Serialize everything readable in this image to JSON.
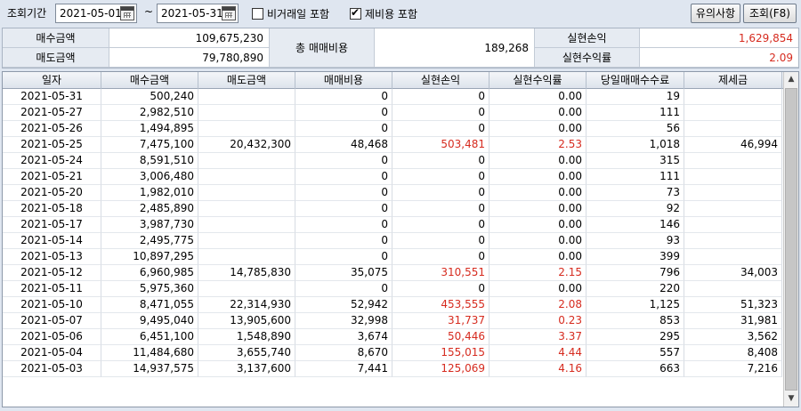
{
  "toolbar": {
    "period_label": "조회기간",
    "date_from": "2021-05-01",
    "tilde": "~",
    "date_to": "2021-05-31",
    "chk_non_trading": "비거래일 포함",
    "chk_fees": "제비용 포함",
    "btn_notice": "유의사항",
    "btn_query": "조회(F8)"
  },
  "summary": {
    "buy_label": "매수금액",
    "buy_value": "109,675,230",
    "sell_label": "매도금액",
    "sell_value": "79,780,890",
    "cost_label": "총 매매비용",
    "cost_value": "189,268",
    "pnl_label": "실현손익",
    "pnl_value": "1,629,854",
    "ret_label": "실현수익률",
    "ret_value": "2.09"
  },
  "table": {
    "headers": [
      "일자",
      "매수금액",
      "매도금액",
      "매매비용",
      "실현손익",
      "실현수익률",
      "당일매매수수료",
      "제세금"
    ],
    "rows": [
      [
        "2021-05-31",
        "500,240",
        "",
        "0",
        "0",
        "0.00",
        "19",
        ""
      ],
      [
        "2021-05-27",
        "2,982,510",
        "",
        "0",
        "0",
        "0.00",
        "111",
        ""
      ],
      [
        "2021-05-26",
        "1,494,895",
        "",
        "0",
        "0",
        "0.00",
        "56",
        ""
      ],
      [
        "2021-05-25",
        "7,475,100",
        "20,432,300",
        "48,468",
        "503,481",
        "2.53",
        "1,018",
        "46,994"
      ],
      [
        "2021-05-24",
        "8,591,510",
        "",
        "0",
        "0",
        "0.00",
        "315",
        ""
      ],
      [
        "2021-05-21",
        "3,006,480",
        "",
        "0",
        "0",
        "0.00",
        "111",
        ""
      ],
      [
        "2021-05-20",
        "1,982,010",
        "",
        "0",
        "0",
        "0.00",
        "73",
        ""
      ],
      [
        "2021-05-18",
        "2,485,890",
        "",
        "0",
        "0",
        "0.00",
        "92",
        ""
      ],
      [
        "2021-05-17",
        "3,987,730",
        "",
        "0",
        "0",
        "0.00",
        "146",
        ""
      ],
      [
        "2021-05-14",
        "2,495,775",
        "",
        "0",
        "0",
        "0.00",
        "93",
        ""
      ],
      [
        "2021-05-13",
        "10,897,295",
        "",
        "0",
        "0",
        "0.00",
        "399",
        ""
      ],
      [
        "2021-05-12",
        "6,960,985",
        "14,785,830",
        "35,075",
        "310,551",
        "2.15",
        "796",
        "34,003"
      ],
      [
        "2021-05-11",
        "5,975,360",
        "",
        "0",
        "0",
        "0.00",
        "220",
        ""
      ],
      [
        "2021-05-10",
        "8,471,055",
        "22,314,930",
        "52,942",
        "453,555",
        "2.08",
        "1,125",
        "51,323"
      ],
      [
        "2021-05-07",
        "9,495,040",
        "13,905,600",
        "32,998",
        "31,737",
        "0.23",
        "853",
        "31,981"
      ],
      [
        "2021-05-06",
        "6,451,100",
        "1,548,890",
        "3,674",
        "50,446",
        "3.37",
        "295",
        "3,562"
      ],
      [
        "2021-05-04",
        "11,484,680",
        "3,655,740",
        "8,670",
        "155,015",
        "4.44",
        "557",
        "8,408"
      ],
      [
        "2021-05-03",
        "14,937,575",
        "3,137,600",
        "7,441",
        "125,069",
        "4.16",
        "663",
        "7,216"
      ]
    ]
  },
  "colors": {
    "positive": "#d62b1f"
  },
  "icons": {
    "calendar": "calendar-icon",
    "scroll_up": "scroll-up-icon",
    "scroll_down": "scroll-down-icon"
  }
}
